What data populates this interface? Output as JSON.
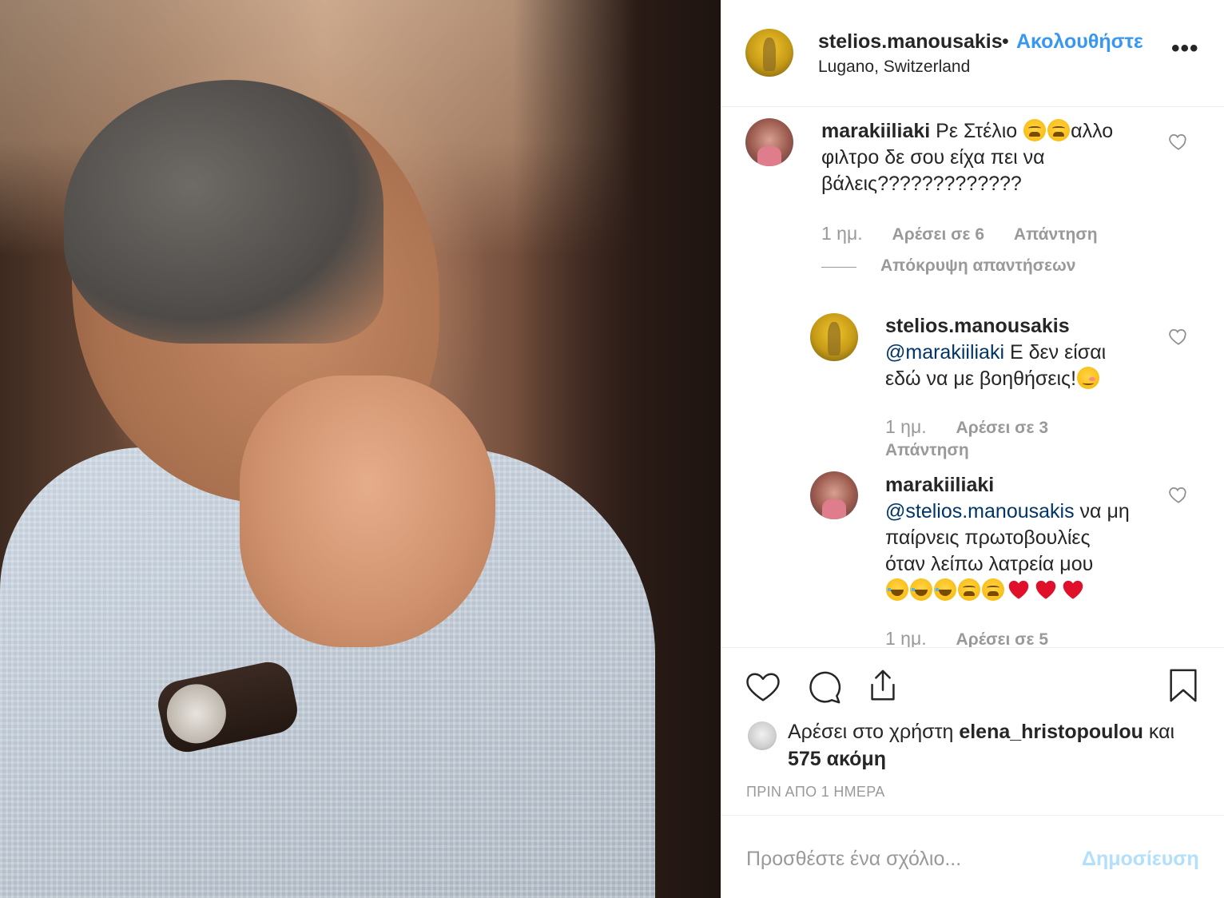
{
  "photo": {
    "description_name": "post-photo"
  },
  "header": {
    "username": "stelios.manousakis",
    "dot": "•",
    "follow_label": "Ακολουθήστε",
    "location": "Lugano, Switzerland",
    "more": "•••"
  },
  "comments": [
    {
      "username": "marakiiliaki",
      "line1_a": "Ρε Στέλιο",
      "line1_b": "αλλο",
      "line2": "φιλτρο δε σου είχα πει να",
      "line3": "βάλεις?????????????",
      "time": "1 ημ.",
      "likes": "Αρέσει σε 6",
      "reply": "Απάντηση",
      "toggle": "Απόκρυψη απαντήσεων"
    },
    {
      "username": "stelios.manousakis",
      "mention": "@marakiiliaki",
      "line1": "Ε δεν είσαι",
      "line2": "εδώ να με βοηθήσεις!",
      "time": "1 ημ.",
      "likes": "Αρέσει σε 3",
      "reply": "Απάντηση"
    },
    {
      "username": "marakiiliaki",
      "mention": "@stelios.manousakis",
      "line1": "να μη",
      "line2": "παίρνεις πρωτοβουλίες",
      "line3": "όταν λείπω λατρεία μου",
      "time": "1 ημ.",
      "likes": "Αρέσει σε 5"
    }
  ],
  "likes": {
    "prefix": "Αρέσει στο χρήστη",
    "user": "elena_hristopoulou",
    "suffix": "και",
    "count": "575 ακόμη"
  },
  "posted_ago": "ΠΡΙΝ ΑΠΟ 1 ΗΜΕΡΑ",
  "add_comment": {
    "placeholder": "Προσθέστε ένα σχόλιο...",
    "post_label": "Δημοσίευση"
  },
  "colors": {
    "link": "#3897f0",
    "mention": "#003569",
    "muted": "#999999",
    "post_disabled": "#b2dffc"
  },
  "icons": [
    "heart-icon",
    "comment-icon",
    "share-icon",
    "bookmark-icon",
    "more-icon"
  ]
}
